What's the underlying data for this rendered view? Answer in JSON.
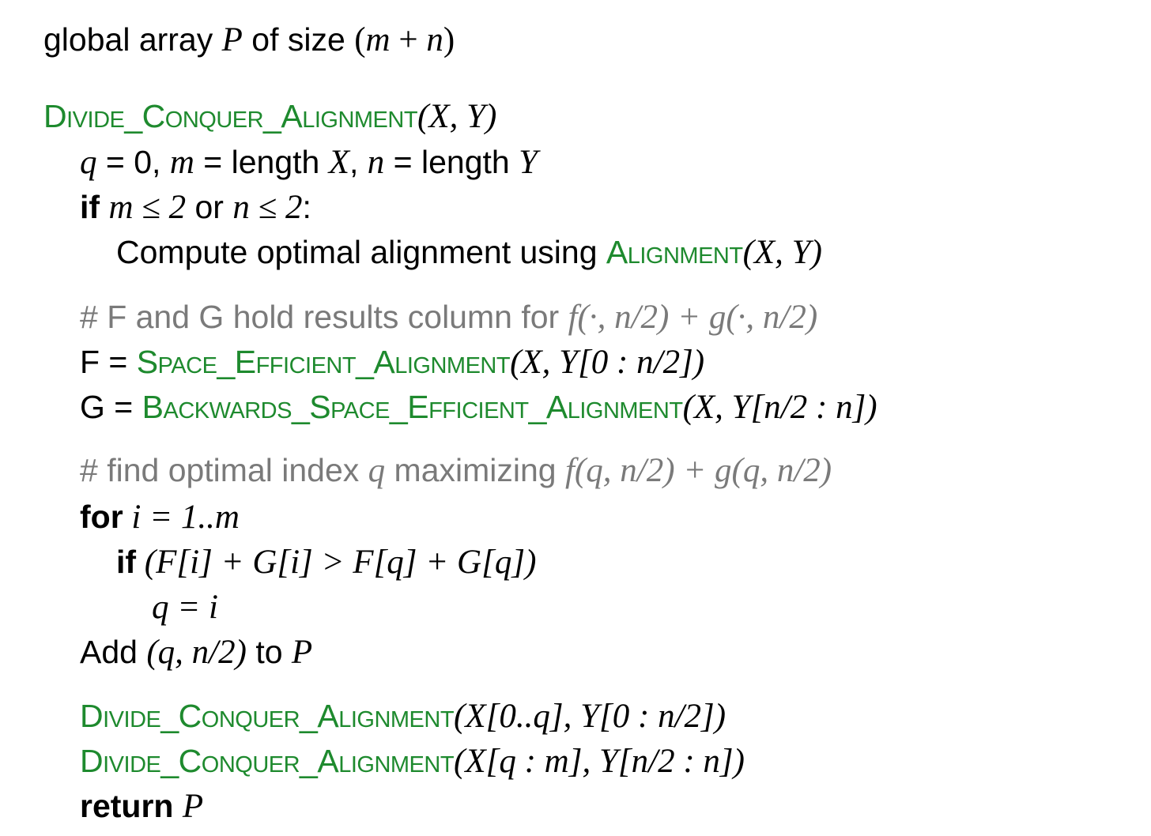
{
  "global_decl": {
    "prefix": "global array ",
    "array_var": "P",
    "mid": " of size ",
    "size_expr_open": "(",
    "size_m": "m",
    "size_plus": " + ",
    "size_n": "n",
    "size_expr_close": ")"
  },
  "function_header": {
    "name": "Divide_Conquer_Alignment",
    "params": "(X, Y)"
  },
  "line_init": {
    "q": "q",
    "eq0": " = 0, ",
    "m": "m",
    "eq_len_x": " = length ",
    "x": "X",
    "comma": ", ",
    "n": "n",
    "eq_len_y": " = length ",
    "y": "Y"
  },
  "line_if_small": {
    "kw": "if",
    "sp": " ",
    "cond1": "m ≤ 2",
    "or": " or ",
    "cond2": "n ≤ 2",
    "colon": ":"
  },
  "line_compute": {
    "text": "Compute optimal alignment using ",
    "fn": "Alignment",
    "args": "(X, Y)"
  },
  "comment_1": {
    "text": "# F and G hold results column for ",
    "expr": "f(·, n/2) + g(·, n/2)"
  },
  "line_f": {
    "lhs": "F = ",
    "fn": "Space_Efficient_Alignment",
    "args": "(X, Y[0 : n/2])"
  },
  "line_g": {
    "lhs": "G = ",
    "fn": "Backwards_Space_Efficient_Alignment",
    "args": "(X, Y[n/2 : n])"
  },
  "comment_2": {
    "text1": "# find optimal index ",
    "q": "q",
    "text2": " maximizing ",
    "expr": "f(q, n/2) + g(q, n/2)"
  },
  "line_for": {
    "kw": "for",
    "expr": " i = 1..m"
  },
  "line_if_better": {
    "kw": "if",
    "expr": " (F[i] + G[i] > F[q] + G[q])"
  },
  "line_assign": {
    "expr": "q = i"
  },
  "line_add": {
    "text1": "Add ",
    "expr": "(q, n/2)",
    "text2": " to ",
    "p": "P"
  },
  "line_rec1": {
    "fn": "Divide_Conquer_Alignment",
    "args": "(X[0..q], Y[0 : n/2])"
  },
  "line_rec2": {
    "fn": "Divide_Conquer_Alignment",
    "args": "(X[q : m], Y[n/2 : n])"
  },
  "line_return": {
    "kw": "return",
    "sp": " ",
    "p": "P"
  },
  "colors": {
    "function_name": "#1e8a2e",
    "comment": "#7a7a7a",
    "text": "#000000"
  }
}
